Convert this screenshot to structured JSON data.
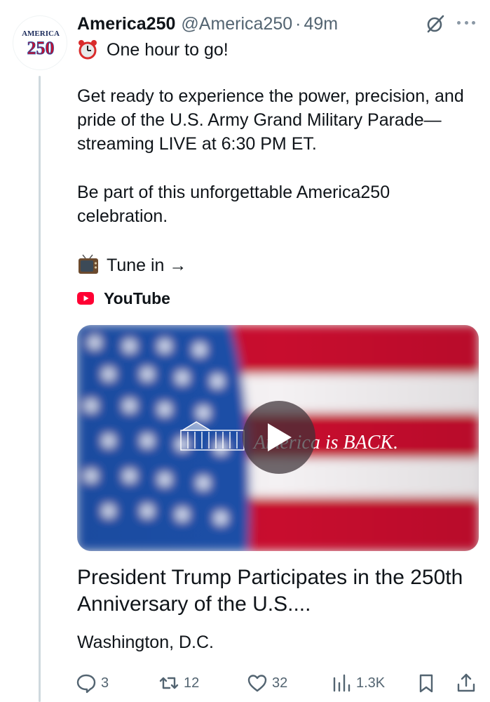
{
  "post": {
    "display_name": "America250",
    "handle": "@America250",
    "separator": "·",
    "time": "49m",
    "avatar_text_top": "AMERICA",
    "avatar_text_bottom": "250",
    "line1": "One hour to go!",
    "para1": "Get ready to experience the power, precision, and pride of the U.S. Army Grand Military Parade—streaming LIVE at 6:30 PM ET.",
    "para2": "Be part of this unforgettable America250 celebration.",
    "tune_in": "Tune in →",
    "link_source": "YouTube"
  },
  "media": {
    "overlay_text": "America is BACK.",
    "play_icon": "play-icon"
  },
  "card": {
    "title": "President Trump Participates in the 250th Anniversary of the U.S....",
    "subtitle": "Washington, D.C."
  },
  "actions": {
    "replies": "3",
    "reposts": "12",
    "likes": "32",
    "views": "1.3K"
  },
  "colors": {
    "text": "#0f1419",
    "secondary": "#536471",
    "youtube_red": "#ff0033",
    "flag_red": "#c8102e",
    "flag_blue": "#1f4fa8"
  }
}
